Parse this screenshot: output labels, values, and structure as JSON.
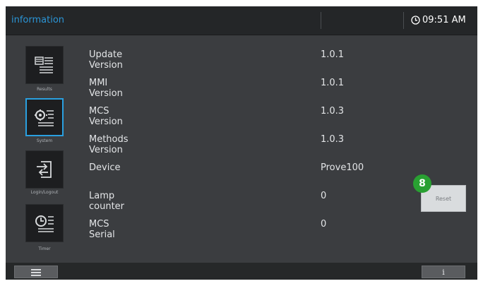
{
  "header": {
    "title": "information",
    "time": "09:51 AM",
    "accent_color": "#2b95d6"
  },
  "sidebar": {
    "items": [
      {
        "label": "Results",
        "icon": "results-icon",
        "active": false
      },
      {
        "label": "System",
        "icon": "system-icon",
        "active": true
      },
      {
        "label": "Login/Logout",
        "icon": "login-logout-icon",
        "active": false
      },
      {
        "label": "Timer",
        "icon": "timer-icon",
        "active": false
      }
    ]
  },
  "info": {
    "rows": [
      {
        "label": "Update Version",
        "value": "1.0.1"
      },
      {
        "label": "MMI Version",
        "value": "1.0.1"
      },
      {
        "label": "MCS Version",
        "value": "1.0.3"
      },
      {
        "label": "Methods Version",
        "value": "1.0.3"
      },
      {
        "label": "Device",
        "value": "Prove100"
      },
      {
        "label": "Lamp counter",
        "value": "0"
      },
      {
        "label": "MCS Serial",
        "value": "0"
      }
    ]
  },
  "reset": {
    "label": "Reset",
    "badge": "8",
    "badge_color": "#29a032"
  },
  "footer": {
    "menu_icon": "hamburger-icon",
    "info_label": "i"
  }
}
